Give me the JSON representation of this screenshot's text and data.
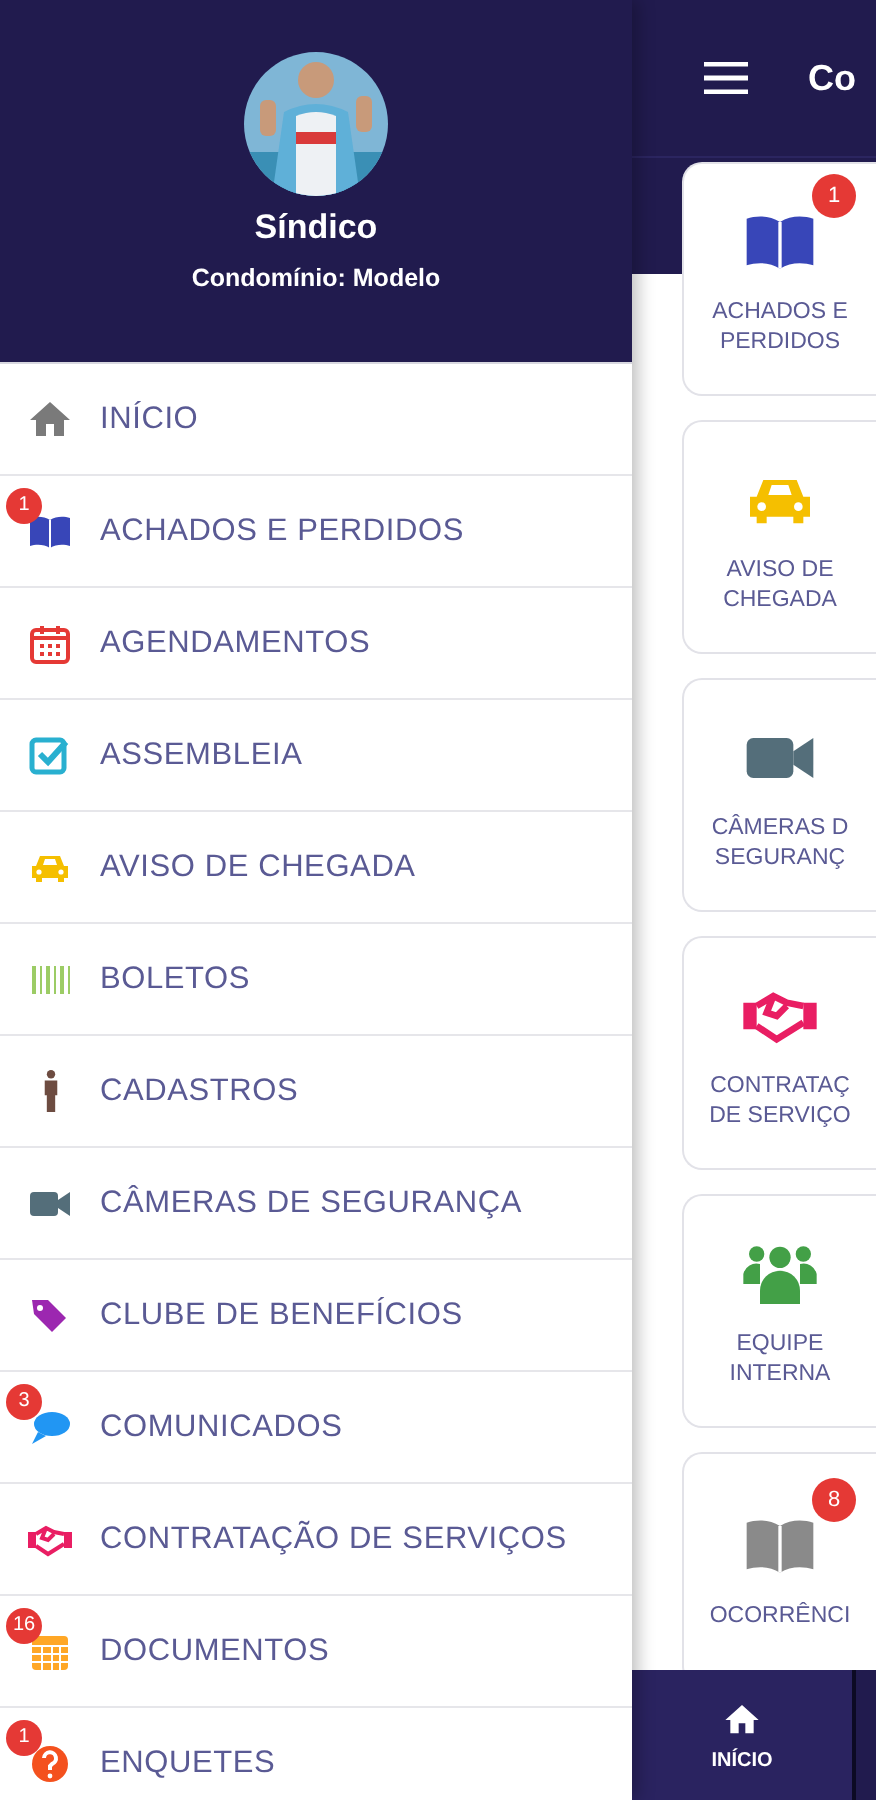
{
  "drawer": {
    "profile": {
      "name": "Síndico",
      "subtitle": "Condomínio: Modelo"
    },
    "menu": [
      {
        "label": "INÍCIO"
      },
      {
        "label": "ACHADOS E PERDIDOS",
        "badge": "1"
      },
      {
        "label": "AGENDAMENTOS"
      },
      {
        "label": "ASSEMBLEIA"
      },
      {
        "label": "AVISO DE CHEGADA"
      },
      {
        "label": "BOLETOS"
      },
      {
        "label": "CADASTROS"
      },
      {
        "label": "CÂMERAS DE SEGURANÇA"
      },
      {
        "label": "CLUBE DE BENEFÍCIOS"
      },
      {
        "label": "COMUNICADOS",
        "badge": "3"
      },
      {
        "label": "CONTRATAÇÃO DE SERVIÇOS"
      },
      {
        "label": "DOCUMENTOS",
        "badge": "16"
      },
      {
        "label": "ENQUETES",
        "badge": "1"
      }
    ]
  },
  "main": {
    "header": {
      "title": "Co"
    },
    "cards": [
      {
        "lines": [
          "ACHADOS E",
          "PERDIDOS"
        ],
        "badge": "1"
      },
      {
        "lines": [
          "AVISO DE",
          "CHEGADA"
        ]
      },
      {
        "lines": [
          "CÂMERAS D",
          "SEGURANÇ"
        ]
      },
      {
        "lines": [
          "CONTRATAÇ",
          "DE SERVIÇO"
        ]
      },
      {
        "lines": [
          "EQUIPE",
          "INTERNA"
        ]
      },
      {
        "lines": [
          "OCORRÊNCI"
        ],
        "badge": "8"
      }
    ],
    "bottom_nav": [
      {
        "label": "INÍCIO",
        "selected": true
      }
    ]
  }
}
